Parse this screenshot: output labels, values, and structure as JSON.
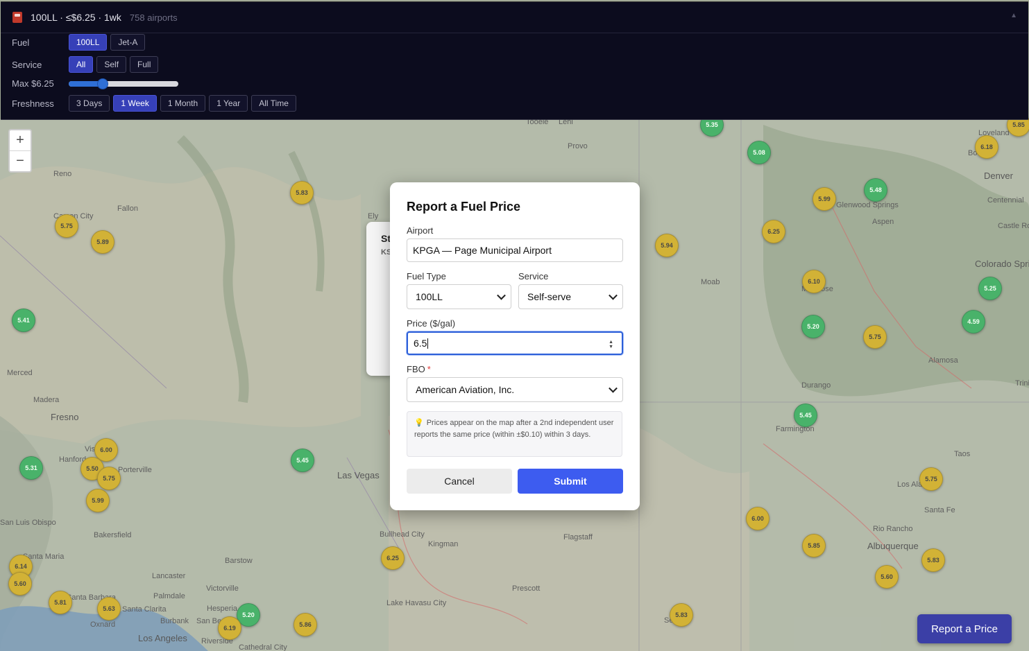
{
  "panel": {
    "summary": "100LL · ≤$6.25 · 1wk",
    "count": "758 airports",
    "fuel_label": "Fuel",
    "fuel_options": [
      "100LL",
      "Jet-A"
    ],
    "fuel_selected": "100LL",
    "service_label": "Service",
    "service_options": [
      "All",
      "Self",
      "Full"
    ],
    "service_selected": "All",
    "max_label": "Max $6.25",
    "max_value_fraction": 0.31,
    "freshness_label": "Freshness",
    "freshness_options": [
      "3 Days",
      "1 Week",
      "1 Month",
      "1 Year",
      "All Time"
    ],
    "freshness_selected": "1 Week"
  },
  "map": {
    "zoom_in": "+",
    "zoom_out": "−",
    "cities": [
      "Tooele",
      "Lehi",
      "Provo",
      "Reno",
      "Fallon",
      "Carson City",
      "Ely",
      "Loveland",
      "Boulder",
      "Denver",
      "Centennial",
      "Castle Rock",
      "Glenwood Springs",
      "Aspen",
      "Moab",
      "Montrose",
      "Colorado Springs",
      "Merced",
      "Madera",
      "Fresno",
      "Visalia",
      "Hanford",
      "Porterville",
      "Las Vegas",
      "Alamosa",
      "Durango",
      "Farmington",
      "Trinidad",
      "Taos",
      "Los Alamos",
      "Santa Fe",
      "Rio Rancho",
      "Albuquerque",
      "San Luis Obispo",
      "Bakersfield",
      "Barstow",
      "Lancaster",
      "Palmdale",
      "Victorville",
      "Santa Barbara",
      "Santa Maria",
      "Santa Clarita",
      "Oxnard",
      "Burbank",
      "San Bernardino",
      "Hesperia",
      "Los Angeles",
      "Riverside",
      "Cathedral City",
      "Bullhead City",
      "Kingman",
      "Flagstaff",
      "Prescott",
      "Lake Havasu City",
      "Sedona"
    ],
    "markers": [
      {
        "price": "5.35",
        "color": "green"
      },
      {
        "price": "5.08",
        "color": "green"
      },
      {
        "price": "6.18",
        "color": "yellow"
      },
      {
        "price": "5.85",
        "color": "yellow"
      },
      {
        "price": "5.48",
        "color": "green"
      },
      {
        "price": "5.99",
        "color": "yellow"
      },
      {
        "price": "5.83",
        "color": "yellow"
      },
      {
        "price": "5.75",
        "color": "yellow"
      },
      {
        "price": "5.89",
        "color": "yellow"
      },
      {
        "price": "6.25",
        "color": "yellow"
      },
      {
        "price": "5.94",
        "color": "yellow"
      },
      {
        "price": "6.10",
        "color": "yellow"
      },
      {
        "price": "5.25",
        "color": "green"
      },
      {
        "price": "4.59",
        "color": "green"
      },
      {
        "price": "5.20",
        "color": "green"
      },
      {
        "price": "5.75",
        "color": "yellow"
      },
      {
        "price": "5.41",
        "color": "green"
      },
      {
        "price": "5.45",
        "color": "green"
      },
      {
        "price": "5.31",
        "color": "green"
      },
      {
        "price": "6.00",
        "color": "yellow"
      },
      {
        "price": "5.50",
        "color": "yellow"
      },
      {
        "price": "5.75",
        "color": "yellow"
      },
      {
        "price": "5.99",
        "color": "yellow"
      },
      {
        "price": "5.45",
        "color": "green"
      },
      {
        "price": "6.25",
        "color": "yellow"
      },
      {
        "price": "5.75",
        "color": "yellow"
      },
      {
        "price": "6.00",
        "color": "yellow"
      },
      {
        "price": "5.85",
        "color": "yellow"
      },
      {
        "price": "5.83",
        "color": "yellow"
      },
      {
        "price": "5.60",
        "color": "yellow"
      },
      {
        "price": "6.14",
        "color": "yellow"
      },
      {
        "price": "5.60",
        "color": "yellow"
      },
      {
        "price": "5.81",
        "color": "yellow"
      },
      {
        "price": "5.63",
        "color": "yellow"
      },
      {
        "price": "5.20",
        "color": "green"
      },
      {
        "price": "6.19",
        "color": "yellow"
      },
      {
        "price": "5.86",
        "color": "yellow"
      },
      {
        "price": "5.83",
        "color": "yellow"
      }
    ]
  },
  "background_card": {
    "title": "St",
    "code": "KS"
  },
  "modal": {
    "title": "Report a Fuel Price",
    "airport_label": "Airport",
    "airport_value": "KPGA — Page Municipal Airport",
    "fuel_type_label": "Fuel Type",
    "fuel_type_value": "100LL",
    "service_label": "Service",
    "service_value": "Self-serve",
    "price_label": "Price ($/gal)",
    "price_value": "6.5",
    "fbo_label": "FBO",
    "fbo_required": "*",
    "fbo_value": "American Aviation, Inc.",
    "note": "Prices appear on the map after a 2nd independent user reports the same price (within ±$0.10) within 3 days.",
    "cancel_label": "Cancel",
    "submit_label": "Submit"
  },
  "report_button": "Report a Price",
  "colors": {
    "accent": "#3d5cf0",
    "panel_bg": "#0c0c1e",
    "active_btn": "#3640b8",
    "marker_yellow": "#c9a20a",
    "marker_green": "#22a24a"
  }
}
